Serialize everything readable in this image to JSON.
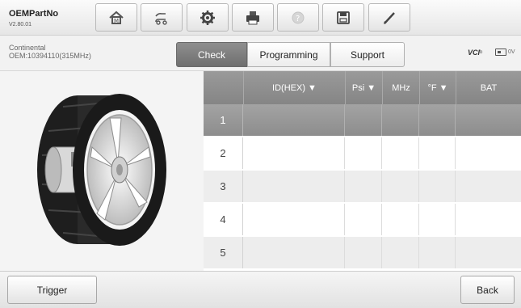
{
  "app": {
    "name": "OEMPartNo",
    "version": "V2.80.01"
  },
  "toolbar": [
    {
      "name": "home-icon"
    },
    {
      "name": "vehicle-swap-icon"
    },
    {
      "name": "gear-icon"
    },
    {
      "name": "printer-icon"
    },
    {
      "name": "help-icon",
      "disabled": true
    },
    {
      "name": "save-icon"
    },
    {
      "name": "pen-icon"
    }
  ],
  "vehicle": {
    "make": "Continental",
    "oem": "OEM:10394110(315MHz)"
  },
  "tabs": [
    {
      "label": "Check",
      "active": true
    },
    {
      "label": "Programming",
      "active": false
    },
    {
      "label": "Support",
      "active": false
    }
  ],
  "status": {
    "vci": "VCI",
    "vci_sub": "b",
    "voltage": "0V"
  },
  "table": {
    "headers": [
      "ID(HEX) ▼",
      "Psi ▼",
      "MHz",
      "°F ▼",
      "BAT"
    ],
    "rows": [
      {
        "num": "1",
        "selected": true
      },
      {
        "num": "2",
        "selected": false
      },
      {
        "num": "3",
        "selected": false
      },
      {
        "num": "4",
        "selected": false
      },
      {
        "num": "5",
        "selected": false
      }
    ]
  },
  "buttons": {
    "trigger": "Trigger",
    "back": "Back"
  }
}
